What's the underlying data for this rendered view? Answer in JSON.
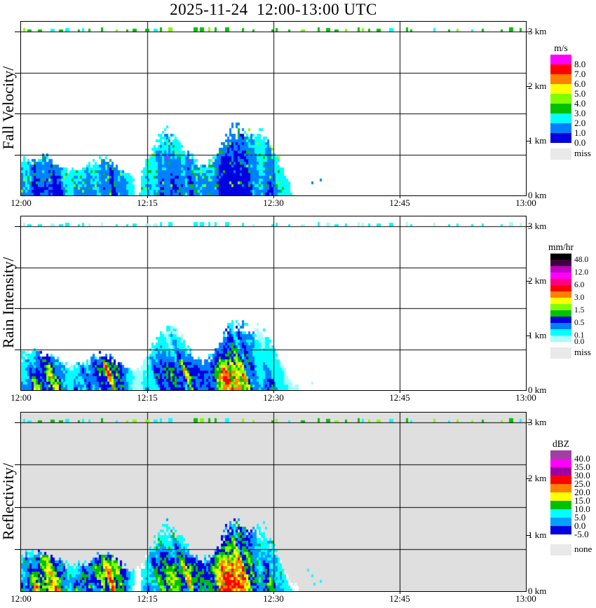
{
  "title": "2025-11-24  12:00-13:00 UTC",
  "axes": {
    "x_ticks": [
      "12:00",
      "12:15",
      "12:30",
      "12:45",
      "13:00"
    ],
    "y_ticks": [
      "3 km",
      "2 km",
      "1 km",
      "0 km"
    ]
  },
  "panels": [
    {
      "id": "fall-velocity",
      "ylabel": "Fall Velocity/",
      "bg": "#FFFFFF",
      "colorbar": {
        "title": "m/s",
        "missing": {
          "label": "miss",
          "color": "#E9E9E9"
        },
        "cells": [
          {
            "color": "#FF00FF",
            "label": "8.0"
          },
          {
            "color": "#FF0000",
            "label": "7.0"
          },
          {
            "color": "#FF8000",
            "label": "6.0"
          },
          {
            "color": "#FFFF00",
            "label": "5.0"
          },
          {
            "color": "#80FF00",
            "label": "4.0"
          },
          {
            "color": "#00C000",
            "label": "3.0"
          },
          {
            "color": "#00FFFF",
            "label": "2.0"
          },
          {
            "color": "#0080FF",
            "label": "1.0"
          },
          {
            "color": "#0000E0",
            "label": "0.0"
          }
        ]
      }
    },
    {
      "id": "rain-intensity",
      "ylabel": "Rain Intensity/",
      "bg": "#FFFFFF",
      "colorbar": {
        "title": "mm/hr",
        "missing": {
          "label": "miss",
          "color": "#E9E9E9"
        },
        "cells": [
          {
            "color": "#000000",
            "label": "48.0"
          },
          {
            "color": "#400040",
            "label": ""
          },
          {
            "color": "#C000C0",
            "label": "12.0"
          },
          {
            "color": "#FF00FF",
            "label": ""
          },
          {
            "color": "#FF0080",
            "label": "6.0"
          },
          {
            "color": "#FF0000",
            "label": ""
          },
          {
            "color": "#FF8000",
            "label": "3.0"
          },
          {
            "color": "#FFFF00",
            "label": ""
          },
          {
            "color": "#80FF00",
            "label": "1.5"
          },
          {
            "color": "#00C000",
            "label": ""
          },
          {
            "color": "#0000E0",
            "label": "0.5"
          },
          {
            "color": "#0080FF",
            "label": ""
          },
          {
            "color": "#00FFFF",
            "label": "0.1"
          },
          {
            "color": "#A0FFFF",
            "label": "0.0"
          }
        ]
      }
    },
    {
      "id": "reflectivity",
      "ylabel": "Reflectivity/",
      "bg": "#DFDFDF",
      "colorbar": {
        "title": "dBZ",
        "missing": {
          "label": "none",
          "color": "#E9E9E9"
        },
        "cells": [
          {
            "color": "#A040A0",
            "label": "40.0"
          },
          {
            "color": "#FF00FF",
            "label": "35.0"
          },
          {
            "color": "#A000A0",
            "label": "30.0"
          },
          {
            "color": "#FF0000",
            "label": "25.0"
          },
          {
            "color": "#FF8000",
            "label": "20.0"
          },
          {
            "color": "#FFFF00",
            "label": "15.0"
          },
          {
            "color": "#00C000",
            "label": "10.0"
          },
          {
            "color": "#00FFFF",
            "label": "5.0"
          },
          {
            "color": "#00A0FF",
            "label": "0.0"
          },
          {
            "color": "#0000E0",
            "label": "-5.0"
          }
        ]
      }
    }
  ],
  "chart_data": [
    {
      "type": "heatmap",
      "title": "Fall Velocity",
      "units": "m/s",
      "x_ticks": [
        "12:00",
        "12:15",
        "12:30",
        "12:45",
        "13:00"
      ],
      "y_range_km": [
        0,
        3
      ],
      "y_ticks_km": [
        0,
        1,
        2,
        3
      ],
      "colorbar_values": [
        8.0,
        7.0,
        6.0,
        5.0,
        4.0,
        3.0,
        2.0,
        1.0,
        0.0
      ],
      "missing_label": "miss",
      "observations": [
        "thin broken echo line at ~3 km across the entire hour (green/chartreuse dashes)",
        "precipitation echoes below ~1.3 km from 12:00 until ~12:33",
        "fall velocities mostly 1-3 m/s (blue/cyan) with green 3-4 m/s patches and isolated magenta ~8 m/s pixels",
        "echo-free below 3 km from ~12:35 to 13:00"
      ]
    },
    {
      "type": "heatmap",
      "title": "Rain Intensity",
      "units": "mm/hr",
      "x_ticks": [
        "12:00",
        "12:15",
        "12:30",
        "12:45",
        "13:00"
      ],
      "y_range_km": [
        0,
        3
      ],
      "y_ticks_km": [
        0,
        1,
        2,
        3
      ],
      "colorbar_values": [
        48.0,
        12.0,
        6.0,
        3.0,
        1.5,
        0.5,
        0.1,
        0.0
      ],
      "missing_label": "miss",
      "observations": [
        "broken cyan echo line at ~3 km across the whole hour",
        "light rain 0-0.5 mm/hr (pale cyan/blue) below ~1.3 km from 12:00 to ~12:33 in slanted fall streaks",
        "cores of 1.5-6 mm/hr with small red >6 mm/hr cells near 12:07-12:12 and 12:17-12:22 below 1 km"
      ]
    },
    {
      "type": "heatmap",
      "title": "Reflectivity",
      "units": "dBZ",
      "x_ticks": [
        "12:00",
        "12:15",
        "12:30",
        "12:45",
        "13:00"
      ],
      "y_range_km": [
        0,
        3
      ],
      "y_ticks_km": [
        0,
        1,
        2,
        3
      ],
      "colorbar_values": [
        40.0,
        35.0,
        30.0,
        25.0,
        20.0,
        15.0,
        10.0,
        5.0,
        0.0,
        -5.0
      ],
      "missing_label": "none",
      "observations": [
        "gray background = no signal (none)",
        "broken green/cyan echo line at ~3 km across the whole hour",
        "reflectivities -5 to 15 dBZ below ~1.3 km from 12:00 to ~12:33 with yellow/orange 15-25 dBZ cores near 12:09-12:12 and 12:17-12:22"
      ]
    }
  ],
  "render": {
    "seed": 1337,
    "cols": 240,
    "cellW": 3,
    "cellH": 4,
    "eventEndCol": 133,
    "bumps": [
      {
        "c": 40,
        "w": 12,
        "a": 0.34,
        "hc": 0.4,
        "hw": 0.34,
        "core": 0.34
      },
      {
        "c": 79,
        "w": 15,
        "a": 0.3,
        "hc": 0.38,
        "hw": 0.32,
        "core": 0.26
      },
      {
        "c": 12,
        "w": 7,
        "a": 0.22,
        "hc": 0.45,
        "hw": 0.3,
        "core": 0.16
      },
      {
        "c": 101,
        "w": 9,
        "a": 0.1,
        "hc": 0.3,
        "hw": 0.28,
        "core": 0.08
      }
    ],
    "dips": [
      {
        "c": 55,
        "w": 4,
        "a": 0.8
      },
      {
        "c": 23,
        "w": 2.5,
        "a": 0.55
      },
      {
        "c": 113,
        "w": 3,
        "a": 0.45
      }
    ],
    "panels": [
      {
        "slant": 0.15,
        "jw": 0.34,
        "gain": 1.0,
        "coreMul": 0.25,
        "floorV": 0,
        "pal": [
          [
            0.14,
            ""
          ],
          [
            0.36,
            "#00FFFF"
          ],
          [
            0.6,
            "#0080FF"
          ],
          [
            2,
            "#0000E0"
          ]
        ],
        "specks": [
          {
            "p": 0.07,
            "min": 0.22,
            "colors": [
              "#00C000",
              "#00C000",
              "#80FF00"
            ]
          },
          {
            "p": 0.004,
            "min": 0.2,
            "colors": [
              "#FF00FF"
            ]
          }
        ],
        "strip": [
          "#00C000",
          "#00C000",
          "#00C000",
          "#00C000",
          "#80FF00",
          "#00FFFF"
        ],
        "dot": "#0080FF"
      },
      {
        "slant": 0.5,
        "jw": 0.24,
        "gain": 1.05,
        "coreMul": 1.0,
        "floorV": 0.12,
        "pal": [
          [
            0.085,
            ""
          ],
          [
            0.25,
            "#A0FFFF"
          ],
          [
            0.42,
            "#00FFFF"
          ],
          [
            0.56,
            "#0080FF"
          ],
          [
            0.67,
            "#0000E0"
          ],
          [
            0.745,
            "#00C000"
          ],
          [
            0.8,
            "#80FF00"
          ],
          [
            0.86,
            "#FFFF00"
          ],
          [
            0.93,
            "#FF8000"
          ],
          [
            2,
            "#FF0000"
          ]
        ],
        "specks": [],
        "strip": [
          "#00FFFF",
          "#00FFFF",
          "#00FFFF",
          "#00FFFF",
          "#A0FFFF"
        ],
        "dot": "#A0FFFF"
      },
      {
        "slant": 0.45,
        "jw": 0.27,
        "gain": 1.14,
        "coreMul": 0.85,
        "floorV": 0.1,
        "pal": [
          [
            0.075,
            ""
          ],
          [
            0.21,
            "#FFFFFF"
          ],
          [
            0.37,
            "#00FFFF"
          ],
          [
            0.5,
            "#00A0FF"
          ],
          [
            0.61,
            "#0000E0"
          ],
          [
            0.7,
            "#00C000"
          ],
          [
            0.77,
            "#80FF00"
          ],
          [
            0.85,
            "#FFFF00"
          ],
          [
            0.94,
            "#FF8000"
          ],
          [
            2,
            "#FF0000"
          ]
        ],
        "specks": [
          {
            "p": 0.05,
            "min": 0.3,
            "colors": [
              "#00C000"
            ]
          }
        ],
        "strip": [
          "#00C000",
          "#00C000",
          "#00FFFF",
          "#00FFFF",
          "#80FF00"
        ],
        "dot": "#00FFFF"
      }
    ]
  }
}
